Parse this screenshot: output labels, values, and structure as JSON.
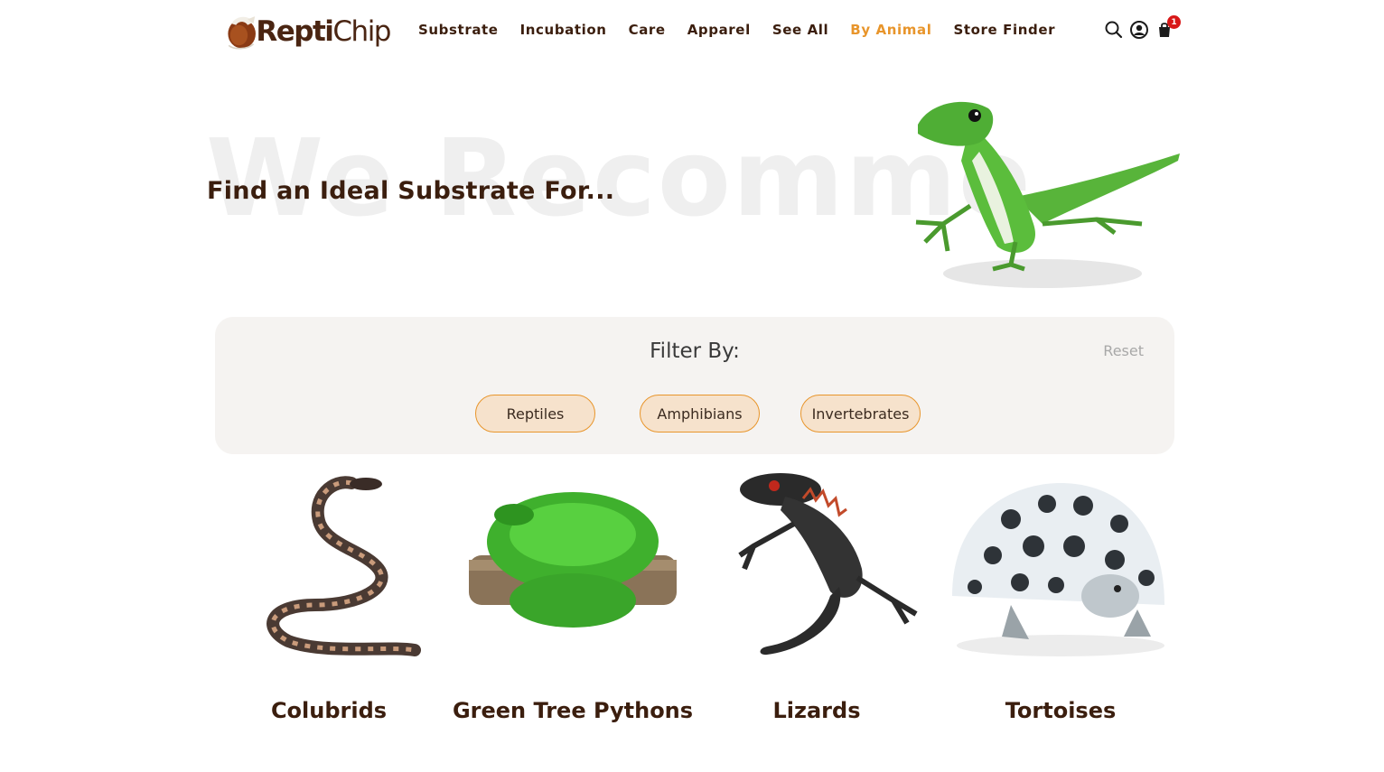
{
  "brand": {
    "name_part1": "Repti",
    "name_part2": "Chip"
  },
  "nav": {
    "items": [
      {
        "label": "Substrate"
      },
      {
        "label": "Incubation"
      },
      {
        "label": "Care"
      },
      {
        "label": "Apparel"
      },
      {
        "label": "See All"
      },
      {
        "label": "By Animal"
      },
      {
        "label": "Store Finder"
      }
    ],
    "active_index": 5,
    "active_color": "#e8952b"
  },
  "header_icons": {
    "search": "search-icon",
    "account": "account-icon",
    "cart": "cart-icon",
    "cart_count": "1"
  },
  "hero": {
    "watermark": "We Recommend",
    "heading": "Find an Ideal Substrate For..."
  },
  "filter": {
    "title": "Filter By:",
    "reset": "Reset",
    "options": [
      {
        "label": "Reptiles"
      },
      {
        "label": "Amphibians"
      },
      {
        "label": "Invertebrates"
      }
    ]
  },
  "animals": [
    {
      "name": "Colubrids"
    },
    {
      "name": "Green Tree Pythons"
    },
    {
      "name": "Lizards"
    },
    {
      "name": "Tortoises"
    }
  ],
  "colors": {
    "brand_brown": "#3b1e0e",
    "accent_orange": "#e8952b",
    "pill_fill": "#f6e2cc",
    "panel_bg": "#f5f3f1"
  }
}
